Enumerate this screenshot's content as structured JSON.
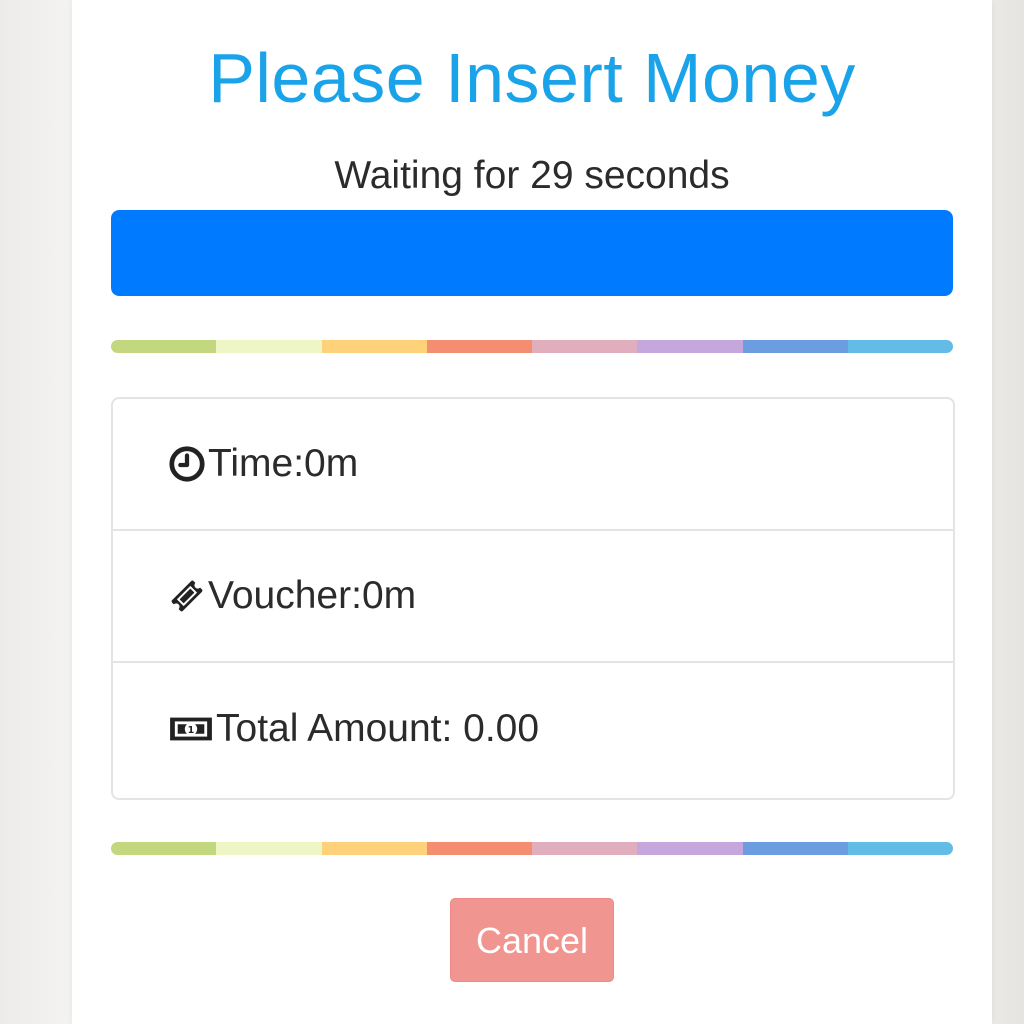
{
  "dialog": {
    "title": "Please Insert Money",
    "waiting_text": "Waiting for 29 seconds",
    "progress_fraction": 1.0
  },
  "summary": {
    "items": [
      {
        "icon": "clock-icon",
        "label": "Time:0m"
      },
      {
        "icon": "ticket-icon",
        "label": "Voucher:0m"
      },
      {
        "icon": "money-bill-icon",
        "label": "Total Amount: 0.00"
      }
    ]
  },
  "actions": {
    "cancel_label": "Cancel"
  },
  "colors": {
    "title": "#1aa3e8",
    "progress": "#007bff",
    "cancel": "#f0958f",
    "rainbow": [
      "#c3d77f",
      "#eff6c6",
      "#fdd27b",
      "#f58e70",
      "#e1aebe",
      "#c5a7de",
      "#6c9de0",
      "#62bce6"
    ]
  }
}
